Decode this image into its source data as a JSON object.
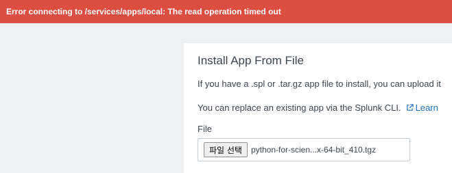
{
  "error_banner": {
    "message": "Error connecting to /services/apps/local: The read operation timed out"
  },
  "install_panel": {
    "title": "Install App From File",
    "description": "If you have a .spl or .tar.gz app file to install, you can upload it",
    "cli_text": "You can replace an existing app via the Splunk CLI.",
    "learn_link": "Learn",
    "file_label": "File",
    "file_button": "파일 선택",
    "file_name": "python-for-scien...x-64-bit_410.tgz"
  },
  "icons": {
    "learn": "external-link-icon"
  },
  "colors": {
    "error": "#dc4e41",
    "link": "#1a6ec0",
    "text": "#3c444d"
  }
}
